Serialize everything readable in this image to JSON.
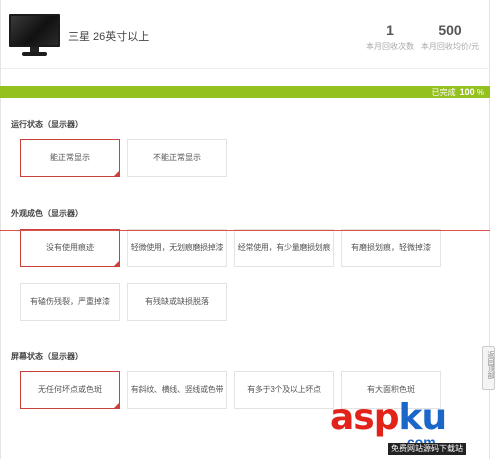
{
  "header": {
    "product_name": "三星 26英寸以上",
    "recycle_count": "1",
    "recycle_count_label": "本月回收次数",
    "avg_price": "500",
    "avg_price_label": "本月回收均价/元"
  },
  "progress": {
    "label": "已完成",
    "percent": "100",
    "symbol": "%",
    "value": 1.0,
    "color": "#95c11f"
  },
  "sections": [
    {
      "title": "运行状态（显示器）",
      "options": [
        {
          "label": "能正常显示",
          "selected": true
        },
        {
          "label": "不能正常显示",
          "selected": false
        }
      ]
    },
    {
      "title": "外观成色（显示器）",
      "options": [
        {
          "label": "没有使用痕迹",
          "selected": true
        },
        {
          "label": "轻微使用，无划痕磨损掉漆",
          "selected": false
        },
        {
          "label": "经常使用，有少量磨损划痕",
          "selected": false
        },
        {
          "label": "有磨损划痕，轻微掉漆",
          "selected": false
        },
        {
          "label": "有磕伤残裂，严重掉漆",
          "selected": false
        },
        {
          "label": "有残缺或缺损脱落",
          "selected": false
        }
      ]
    },
    {
      "title": "屏幕状态（显示器）",
      "options": [
        {
          "label": "无任何坏点或色斑",
          "selected": true
        },
        {
          "label": "有斜纹、横线、竖线或色带",
          "selected": false
        },
        {
          "label": "有多于3个及以上坏点",
          "selected": false
        },
        {
          "label": "有大面积色斑",
          "selected": false
        }
      ]
    }
  ],
  "side_tab": {
    "label": "返回顶部"
  },
  "watermark": {
    "main": "aspku",
    "sub": ".com",
    "tagline": "免费网站源码下载站"
  },
  "colors": {
    "accent_green": "#95c11f",
    "selected_red": "#c8413a",
    "watermark_red": "#e2231a",
    "watermark_blue": "#1b66c9"
  }
}
